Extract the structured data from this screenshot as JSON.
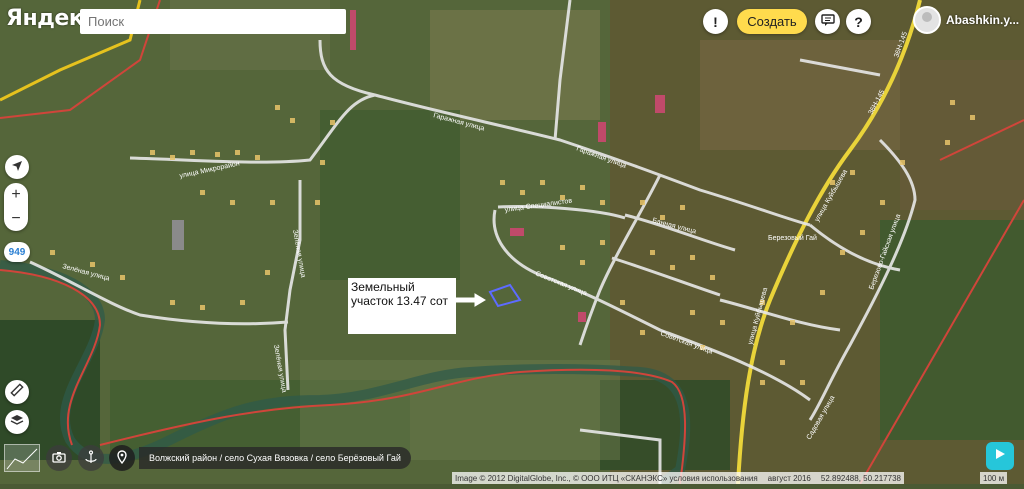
{
  "header": {
    "logo": "Яндекс",
    "search_placeholder": "Поиск",
    "create_label": "Создать",
    "alert_icon": "!",
    "help_icon": "?",
    "user_name": "Abashkin.y..."
  },
  "controls": {
    "zoom_in": "+",
    "zoom_out": "−",
    "route_badge": "949"
  },
  "map_labels": {
    "garazhnaya_1": "Гаражная улица",
    "garazhnaya_2": "Гаражная улица",
    "mikrorayon": "улица Микрорайон",
    "spetsialistov": "улица Специалистов",
    "bannaya": "Банная улица",
    "sovetskaya_1": "Советская улица",
    "sovetskaya_2": "Советская улица",
    "zelenaya_1": "Зелёная улица",
    "zelenaya_2": "Зелёная улица",
    "zelenaya_3": "Зелёная улица",
    "kuybysheva_1": "улица Куйбышева",
    "kuybysheva_2": "улица Куйбышева",
    "berezovy_gay": "Березовый Гай",
    "berezovaya_gayskaya": "Березово-Гайская улица",
    "sadovaya": "Садовая улица",
    "road_code_1": "36Н-145",
    "road_code_2": "36Н-145",
    "plot_note": "Земельный участок 13.47 сот"
  },
  "bottom": {
    "breadcrumb": "Волжский район / село Сухая Вязовка / село Берёзовый Гай",
    "copyright": "Image © 2012 DigitalGlobe, Inc., © ООО ИТЦ «СКАНЭКС» условия использования",
    "date": "август 2016",
    "coords": "52.892488, 50.217738",
    "scale": "100 м"
  }
}
